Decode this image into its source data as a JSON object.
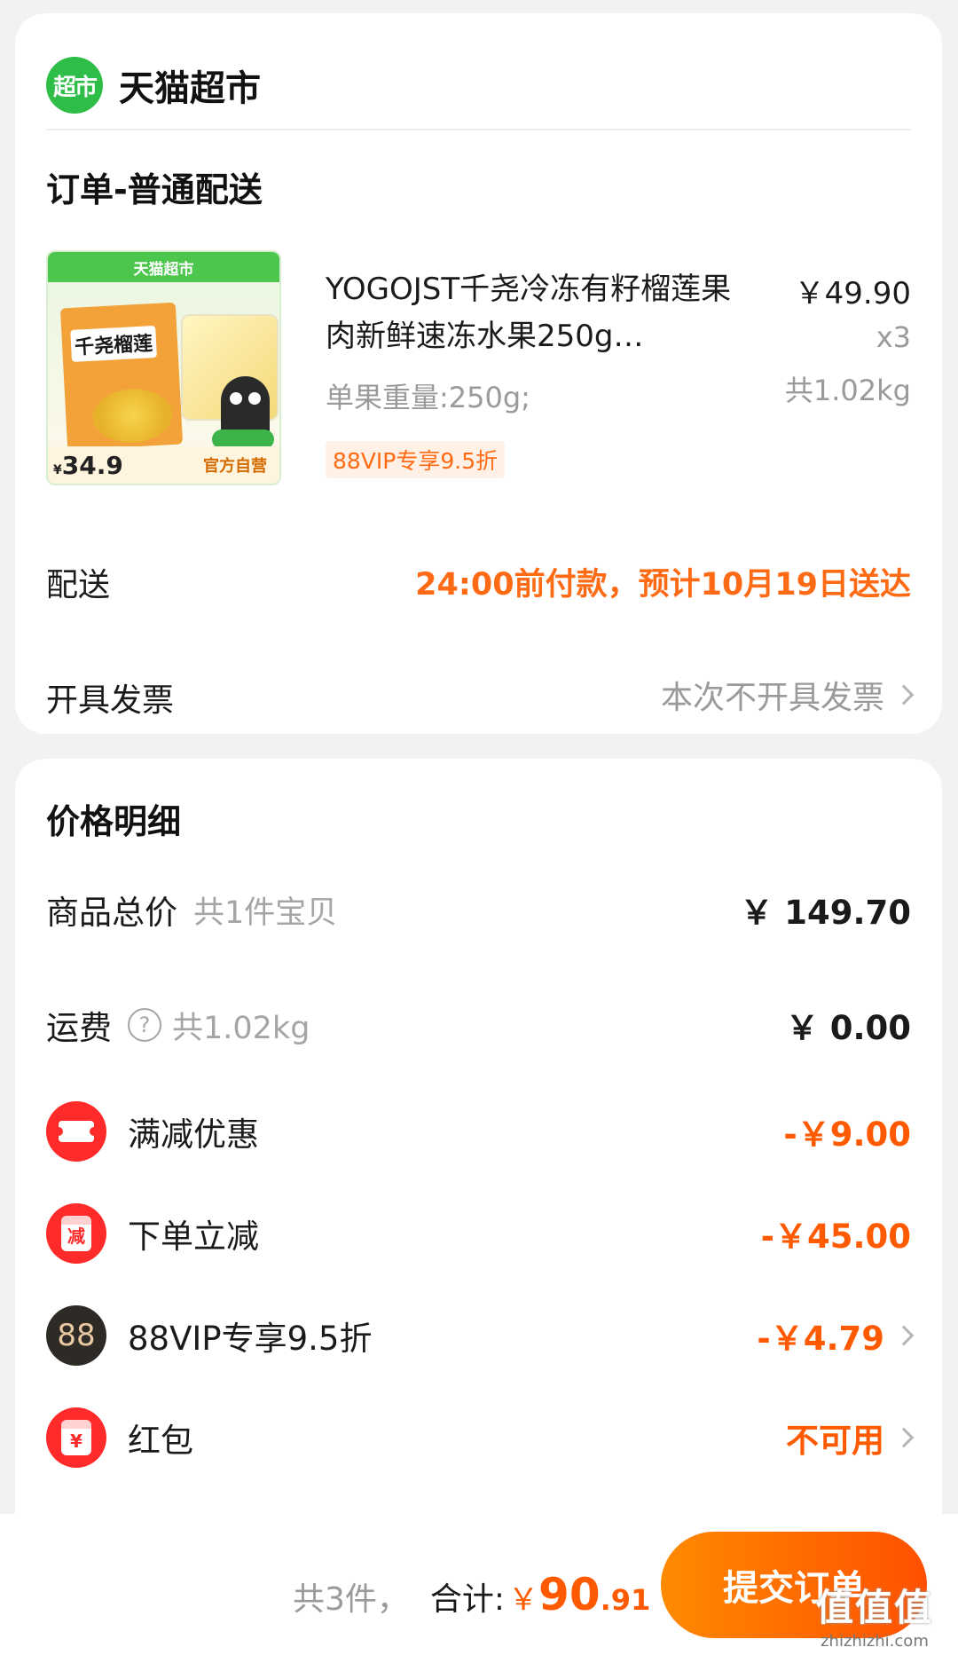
{
  "store": {
    "logo_text": "超市",
    "name": "天猫超市"
  },
  "order": {
    "section_title": "订单-普通配送",
    "product": {
      "image_banner": "天猫超市",
      "image_box_title": "千尧榴莲",
      "image_price": "34.9",
      "image_self_label": "官方自营",
      "title": "YOGOJST千尧冷冻有籽榴莲果肉新鲜速冻水果250g…",
      "spec": "单果重量:250g;",
      "vip_badge": "88VIP专享9.5折",
      "price": "￥49.90",
      "qty": "x3",
      "weight": "共1.02kg"
    },
    "delivery": {
      "label": "配送",
      "value": "24:00前付款，预计10月19日送达"
    },
    "invoice": {
      "label": "开具发票",
      "value": "本次不开具发票"
    }
  },
  "price_detail": {
    "title": "价格明细",
    "goods_total": {
      "label": "商品总价",
      "sub": "共1件宝贝",
      "value": "￥ 149.70"
    },
    "shipping": {
      "label": "运费",
      "sub": "共1.02kg",
      "value": "￥ 0.00",
      "icon": "question-icon"
    },
    "discounts": [
      {
        "label": "满减优惠",
        "value": "-￥9.00",
        "icon": "coupon-icon",
        "has_chevron": false
      },
      {
        "label": "下单立减",
        "value": "-￥45.00",
        "icon": "minus-badge-icon",
        "icon_text": "减",
        "has_chevron": false
      },
      {
        "label": "88VIP专享9.5折",
        "value": "-￥4.79",
        "icon": "vip88-icon",
        "icon_text": "88",
        "has_chevron": true
      },
      {
        "label": "红包",
        "value": "不可用",
        "icon": "red-packet-icon",
        "icon_text": "¥",
        "has_chevron": true
      }
    ]
  },
  "bottom_bar": {
    "count": "共3件，",
    "total_label": "合计:",
    "currency": "￥",
    "total_int": "90",
    "total_dec": ".91",
    "submit_label": "提交订单",
    "watermark_glyph": "值值值",
    "watermark_url": "zhizhizhi.com"
  },
  "colors": {
    "accent": "#ff5a00",
    "tmall_green": "#2ebd47",
    "coupon_red": "#ff2b2b"
  }
}
